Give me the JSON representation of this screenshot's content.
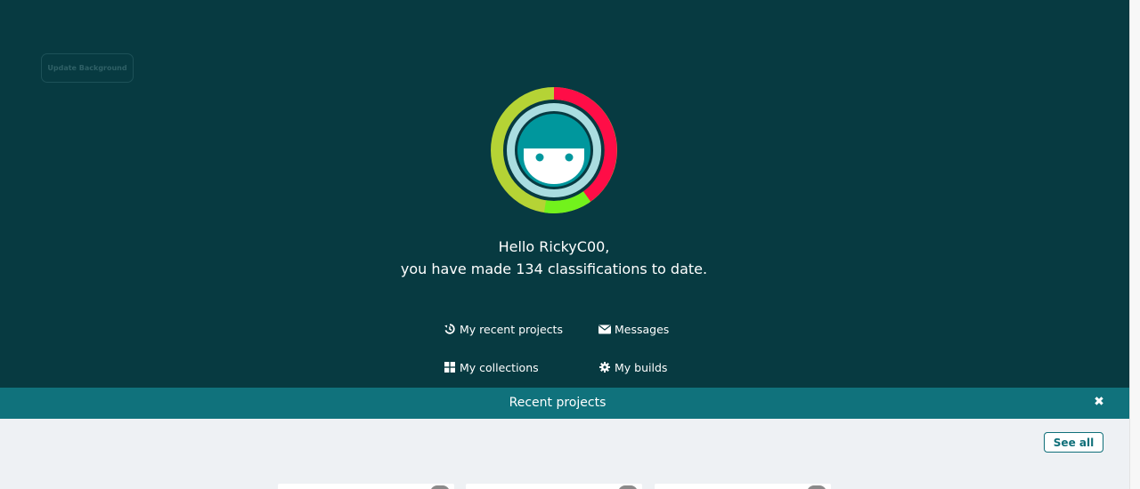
{
  "hero": {
    "update_background_label": "Update Background",
    "greeting_line1": "Hello RickyC00,",
    "greeting_line2": "you have made 134 classifications to date.",
    "avatar_icon": "zooniverse-face-avatar",
    "ring_colors": {
      "red": "#ff0d47",
      "yellow_green": "#b5d335",
      "bright_green": "#72f21c",
      "inner_light": "#a9dde0",
      "face": "#00979d",
      "background": "#073a41"
    }
  },
  "nav": {
    "recent_projects": {
      "label": "My recent projects",
      "icon": "history-icon"
    },
    "messages": {
      "label": "Messages",
      "icon": "envelope-icon"
    },
    "collections": {
      "label": "My collections",
      "icon": "grid-icon"
    },
    "builds": {
      "label": "My builds",
      "icon": "gear-icon"
    }
  },
  "recent_section": {
    "title": "Recent projects",
    "close_icon": "close-icon",
    "see_all_label": "See all"
  },
  "colors": {
    "hero_bg": "#073a41",
    "section_bar": "#10727c",
    "page_bg": "#eef1f4",
    "accent": "#0f6f79"
  }
}
